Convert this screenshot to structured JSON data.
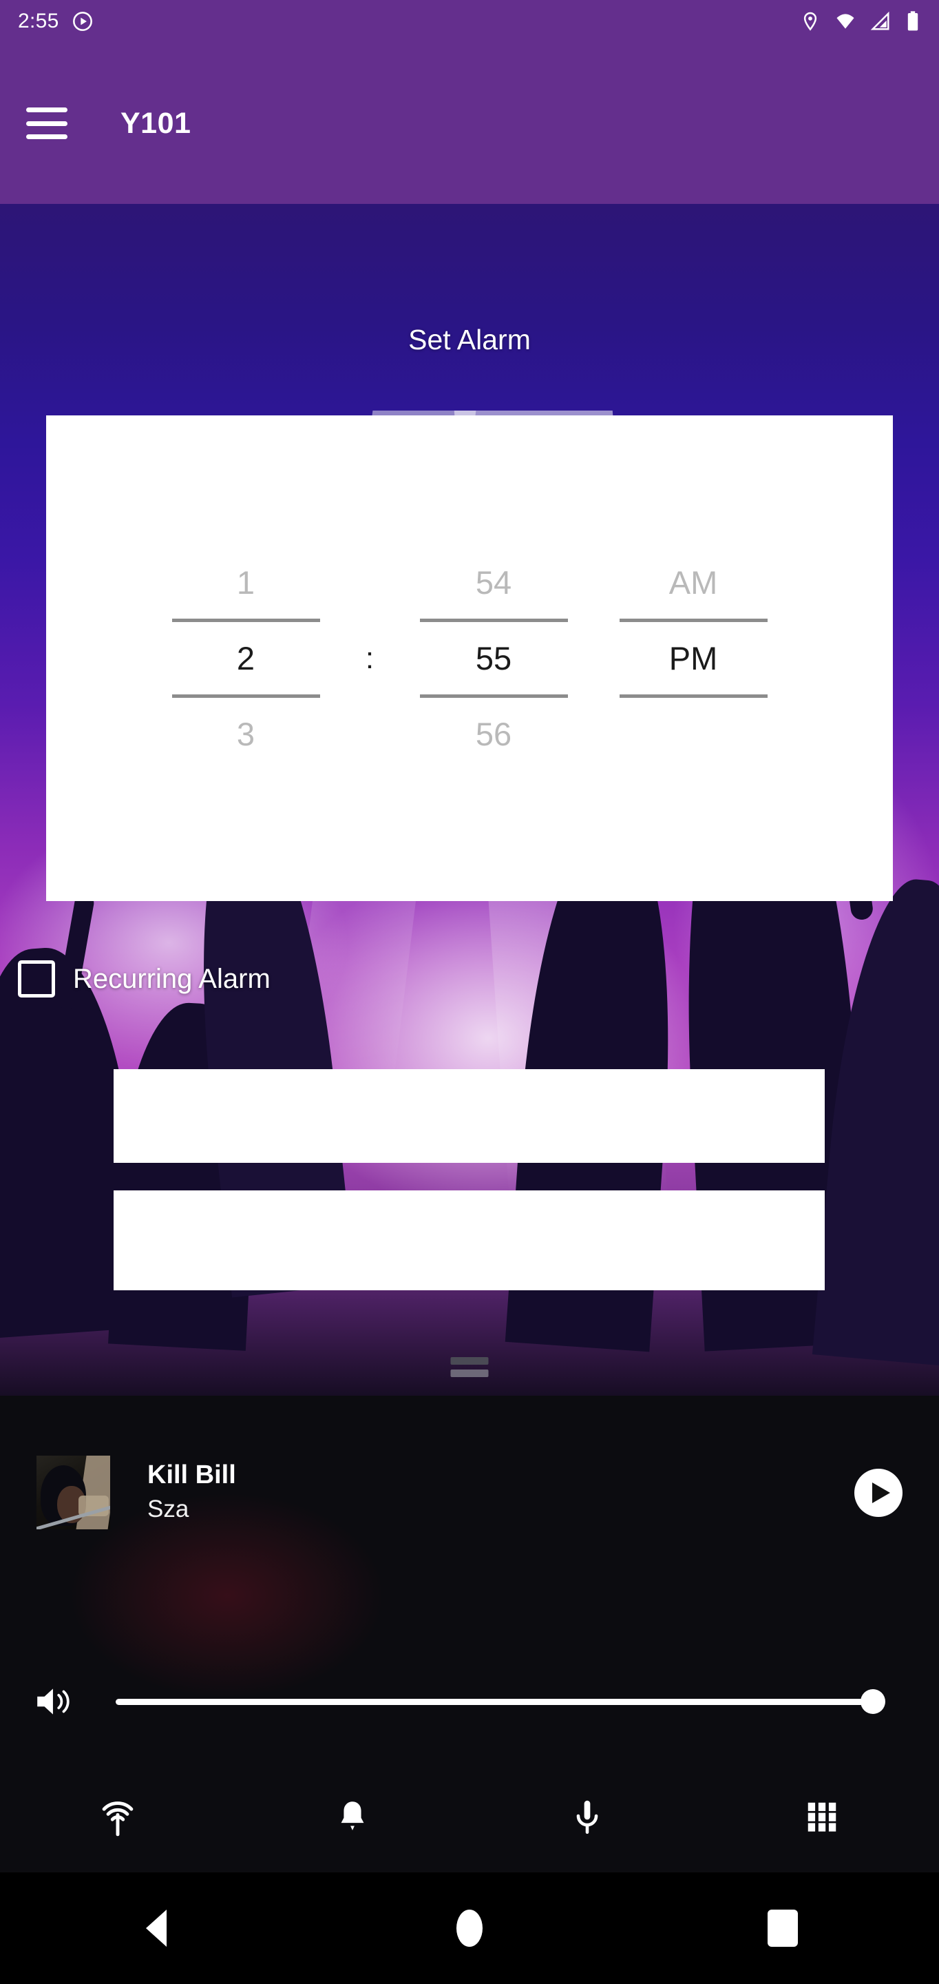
{
  "status_bar": {
    "time": "2:55",
    "icons": [
      "play-circle-icon",
      "location-pin-icon",
      "wifi-icon",
      "cell-signal-icon",
      "battery-icon"
    ]
  },
  "app_bar": {
    "menu_icon": "hamburger-menu-icon",
    "title": "Y101"
  },
  "screen": {
    "heading": "Set Alarm"
  },
  "time_picker": {
    "hour": {
      "previous": "1",
      "selected": "2",
      "next": "3"
    },
    "separator": ":",
    "minute": {
      "previous": "54",
      "selected": "55",
      "next": "56"
    },
    "meridiem": {
      "previous": "AM",
      "selected": "PM",
      "next": ""
    }
  },
  "recurring": {
    "label": "Recurring Alarm",
    "checked": "false"
  },
  "blank_buttons": [
    {
      "label": ""
    },
    {
      "label": ""
    }
  ],
  "player": {
    "track_title": "Kill Bill",
    "artist": "Sza",
    "play_icon": "play-icon",
    "album_art_alt": "album-art",
    "volume_icon": "volume-high-icon",
    "volume_level": "100"
  },
  "bottom_tabs": [
    {
      "icon": "broadcast-icon",
      "label": ""
    },
    {
      "icon": "bell-icon",
      "label": ""
    },
    {
      "icon": "microphone-icon",
      "label": ""
    },
    {
      "icon": "grid-apps-icon",
      "label": ""
    }
  ],
  "system_nav": [
    {
      "icon": "back-icon"
    },
    {
      "icon": "home-icon"
    },
    {
      "icon": "recents-icon"
    }
  ],
  "colors": {
    "app_bar": "#642f8d",
    "card": "#ffffff",
    "player_bg": "#0c0c10",
    "accent_text": "#ffffff"
  }
}
